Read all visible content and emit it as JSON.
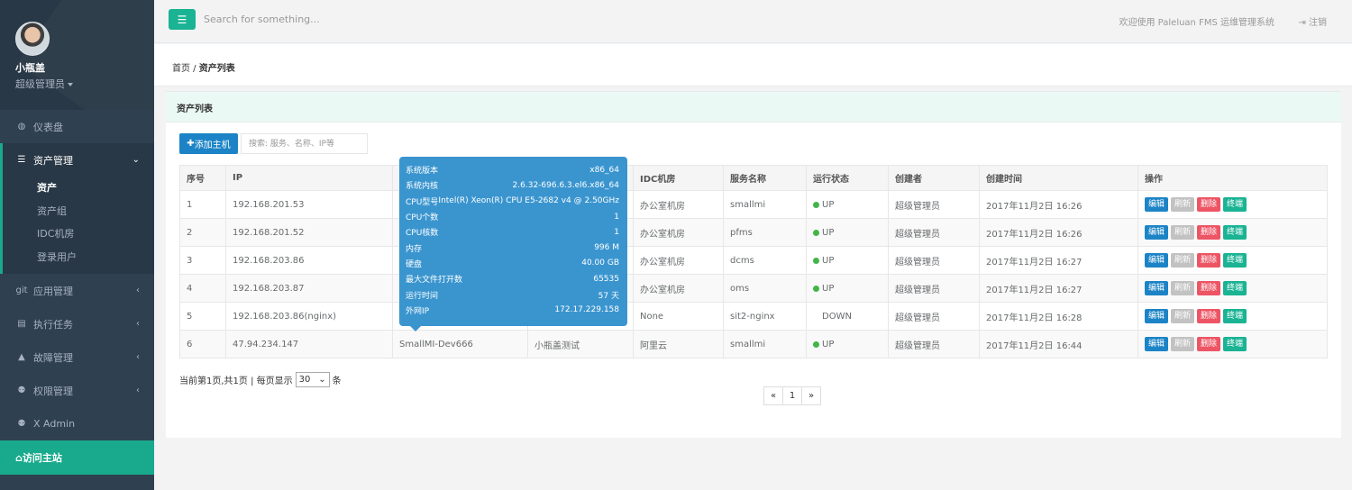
{
  "user": {
    "name": "小瓶盖",
    "role": "超级管理员"
  },
  "nav": {
    "dashboard": "仪表盘",
    "assets": "资产管理",
    "assets_sub": [
      "资产",
      "资产组",
      "IDC机房",
      "登录用户"
    ],
    "apps": "应用管理",
    "tasks": "执行任务",
    "faults": "故障管理",
    "perms": "权限管理",
    "xadmin": "X Admin",
    "visit": "访问主站"
  },
  "topbar": {
    "search_placeholder": "Search for something...",
    "welcome": "欢迎使用 Paleluan FMS 运维管理系统",
    "logout": "注销"
  },
  "breadcrumb": {
    "home": "首页",
    "sep": " / ",
    "current": "资产列表"
  },
  "panel": {
    "title": "资产列表",
    "add_button": "添加主机",
    "filter_placeholder": "搜索: 服务、名称、IP等"
  },
  "table": {
    "headers": [
      "序号",
      "IP",
      "",
      "",
      "IDC机房",
      "服务名称",
      "运行状态",
      "创建者",
      "创建时间",
      "操作"
    ],
    "rows": [
      {
        "no": "1",
        "ip": "192.168.201.53",
        "host": "",
        "desc": "",
        "idc": "办公室机房",
        "service": "smallmi",
        "status": "UP",
        "creator": "超级管理员",
        "time": "2017年11月2日 16:26"
      },
      {
        "no": "2",
        "ip": "192.168.201.52",
        "host": "",
        "desc": "",
        "idc": "办公室机房",
        "service": "pfms",
        "status": "UP",
        "creator": "超级管理员",
        "time": "2017年11月2日 16:26"
      },
      {
        "no": "3",
        "ip": "192.168.203.86",
        "host": "",
        "desc": "",
        "idc": "办公室机房",
        "service": "dcms",
        "status": "UP",
        "creator": "超级管理员",
        "time": "2017年11月2日 16:27"
      },
      {
        "no": "4",
        "ip": "192.168.203.87",
        "host": "",
        "desc": "",
        "idc": "办公室机房",
        "service": "oms",
        "status": "UP",
        "creator": "超级管理员",
        "time": "2017年11月2日 16:27"
      },
      {
        "no": "5",
        "ip": "192.168.203.86(nginx)",
        "host": "",
        "desc": "",
        "idc": "None",
        "service": "sit2-nginx",
        "status": "DOWN",
        "creator": "超级管理员",
        "time": "2017年11月2日 16:28"
      },
      {
        "no": "6",
        "ip": "47.94.234.147",
        "host": "SmallMI-Dev666",
        "desc": "小瓶盖测试",
        "idc": "阿里云",
        "service": "smallmi",
        "status": "UP",
        "creator": "超级管理员",
        "time": "2017年11月2日 16:44"
      }
    ],
    "ops": {
      "edit": "编辑",
      "refresh": "刷新",
      "delete": "删除",
      "terminal": "终端"
    }
  },
  "pagination": {
    "info": "当前第1页,共1页 | 每页显示",
    "per_page": "30",
    "unit": "条",
    "prev": "«",
    "page": "1",
    "next": "»"
  },
  "tooltip": [
    {
      "k": "系统版本",
      "v": "x86_64"
    },
    {
      "k": "系统内核",
      "v": "2.6.32-696.6.3.el6.x86_64"
    },
    {
      "k": "CPU型号",
      "v": "Intel(R) Xeon(R) CPU E5-2682 v4 @ 2.50GHz"
    },
    {
      "k": "CPU个数",
      "v": "1"
    },
    {
      "k": "CPU核数",
      "v": "1"
    },
    {
      "k": "内存",
      "v": "996 M"
    },
    {
      "k": "硬盘",
      "v": "40.00 GB"
    },
    {
      "k": "最大文件打开数",
      "v": "65535"
    },
    {
      "k": "运行时间",
      "v": "57 天"
    },
    {
      "k": "外网IP",
      "v": "172.17.229.158"
    }
  ],
  "colors": {
    "sidebar": "#2f4050",
    "accent": "#1ab394",
    "primary": "#1c84c6",
    "danger": "#ed5565"
  }
}
